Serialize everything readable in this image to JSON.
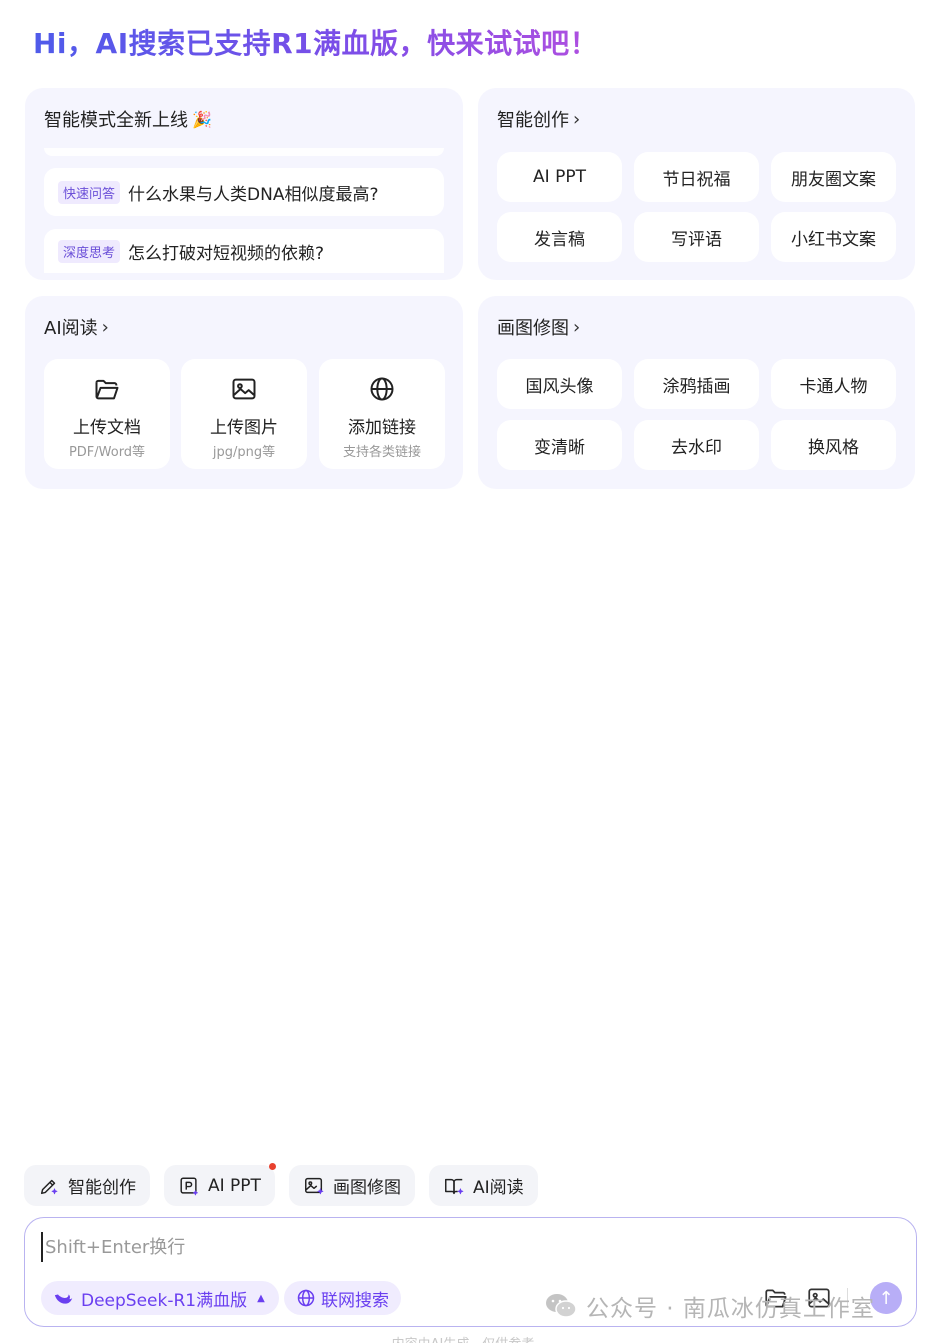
{
  "headline": "Hi，AI搜索已支持R1满血版，快来试试吧！",
  "smart_mode": {
    "title": "智能模式全新上线",
    "items": [
      {
        "tag": "快速问答",
        "question": "什么水果与人类DNA相似度最高?"
      },
      {
        "tag": "深度思考",
        "question": "怎么打破对短视频的依赖?"
      }
    ]
  },
  "smart_create": {
    "title": "智能创作",
    "items": [
      "AI PPT",
      "节日祝福",
      "朋友圈文案",
      "发言稿",
      "写评语",
      "小红书文案"
    ]
  },
  "ai_read": {
    "title": "AI阅读",
    "tiles": [
      {
        "label": "上传文档",
        "sub": "PDF/Word等"
      },
      {
        "label": "上传图片",
        "sub": "jpg/png等"
      },
      {
        "label": "添加链接",
        "sub": "支持各类链接"
      }
    ]
  },
  "image_edit": {
    "title": "画图修图",
    "items": [
      "国风头像",
      "涂鸦插画",
      "卡通人物",
      "变清晰",
      "去水印",
      "换风格"
    ]
  },
  "shortcuts": [
    "智能创作",
    "AI PPT",
    "画图修图",
    "AI阅读"
  ],
  "input": {
    "placeholder": "Shift+Enter换行",
    "model": "DeepSeek-R1满血版",
    "web_search": "联网搜索"
  },
  "watermark": "公众号 · 南瓜冰仿真工作室",
  "footnote": "内容由AI生成，仅供参考",
  "colors": {
    "accent": "#6a3ff0",
    "card_bg": "#f5f5fe",
    "chip_bg": "#f3f4f8",
    "notification_dot": "#e8412f"
  }
}
